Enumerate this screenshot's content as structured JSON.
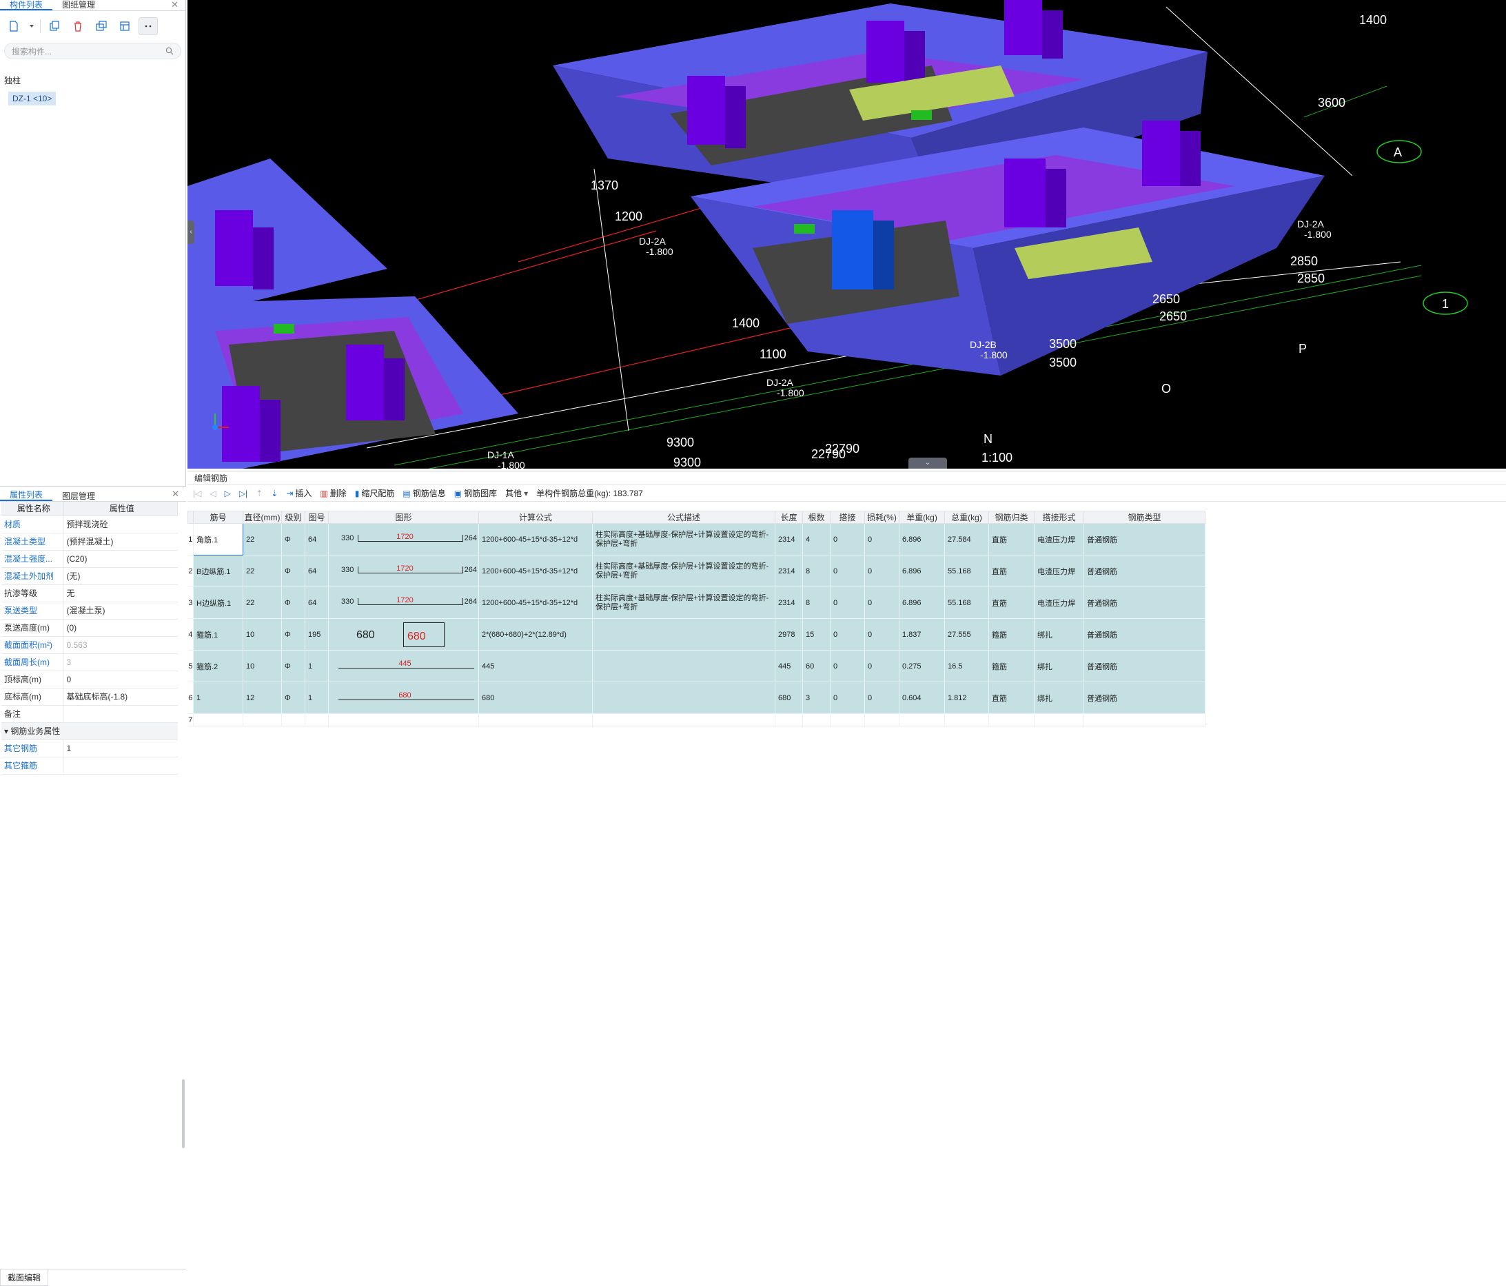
{
  "left_panel": {
    "tabs": [
      "构件列表",
      "图纸管理"
    ],
    "search_placeholder": "搜索构件...",
    "tree_group": "独柱",
    "tree_item": "DZ-1 <10>"
  },
  "props_panel": {
    "tabs": [
      "属性列表",
      "图层管理"
    ],
    "headers": [
      "属性名称",
      "属性值"
    ],
    "rows": [
      {
        "name": "材质",
        "value": "预拌现浇砼",
        "blue": true
      },
      {
        "name": "混凝土类型",
        "value": "(预拌混凝土)",
        "blue": true
      },
      {
        "name": "混凝土强度...",
        "value": "(C20)",
        "blue": true
      },
      {
        "name": "混凝土外加剂",
        "value": "(无)",
        "blue": true
      },
      {
        "name": "抗渗等级",
        "value": "无",
        "blue": false
      },
      {
        "name": "泵送类型",
        "value": "(混凝土泵)",
        "blue": true
      },
      {
        "name": "泵送高度(m)",
        "value": "(0)",
        "blue": false
      },
      {
        "name": "截面面积(m²)",
        "value": "0.563",
        "blue": true,
        "gray": true
      },
      {
        "name": "截面周长(m)",
        "value": "3",
        "blue": true,
        "gray": true
      },
      {
        "name": "顶标高(m)",
        "value": "0",
        "blue": false
      },
      {
        "name": "底标高(m)",
        "value": "基础底标高(-1.8)",
        "blue": false
      },
      {
        "name": "备注",
        "value": "",
        "blue": false
      }
    ],
    "section": "钢筋业务属性",
    "extra_rows": [
      {
        "name": "其它钢筋",
        "value": "1"
      },
      {
        "name": "其它箍筋",
        "value": ""
      }
    ],
    "bottom_tab": "截面编辑"
  },
  "viewport": {
    "dims": [
      "9300",
      "9300",
      "22790",
      "22790",
      "3500",
      "3500",
      "2650",
      "2650",
      "2850",
      "2850",
      "3600",
      "1400",
      "1100",
      "1200",
      "1370",
      "1400"
    ],
    "labels": [
      "DJ-1A",
      "-1.800",
      "DJ-2A",
      "-1.800",
      "DJ-2B",
      "-1.800",
      "DJ-2A",
      "-1.800",
      "DJ-2A",
      "-1.800"
    ],
    "axis_labels": [
      "A",
      "1",
      "P",
      "O",
      "N"
    ],
    "scale": "1:100"
  },
  "editor": {
    "title": "编辑钢筋",
    "toolbar": {
      "insert": "插入",
      "delete": "删除",
      "scale_rebar": "缩尺配筋",
      "rebar_info": "钢筋信息",
      "rebar_lib": "钢筋图库",
      "other": "其他",
      "total": "单构件钢筋总重(kg): 183.787"
    },
    "columns": [
      "筋号",
      "直径(mm)",
      "级别",
      "图号",
      "图形",
      "计算公式",
      "公式描述",
      "长度",
      "根数",
      "搭接",
      "损耗(%)",
      "单重(kg)",
      "总重(kg)",
      "钢筋归类",
      "搭接形式",
      "钢筋类型"
    ],
    "rows": [
      {
        "no": "1",
        "name": "角筋.1",
        "dia": "22",
        "grade": "Φ",
        "fig": "64",
        "shape_left": "330",
        "shape_mid": "1720",
        "shape_right": "264",
        "formula": "1200+600-45+15*d-35+12*d",
        "desc": "柱实际高度+基础厚度-保护层+计算设置设定的弯折-保护层+弯折",
        "len": "2314",
        "count": "4",
        "lap": "0",
        "loss": "0",
        "unit_w": "6.896",
        "total_w": "27.584",
        "cls": "直筋",
        "lap_form": "电渣压力焊",
        "type": "普通钢筋"
      },
      {
        "no": "2",
        "name": "B边纵筋.1",
        "dia": "22",
        "grade": "Φ",
        "fig": "64",
        "shape_left": "330",
        "shape_mid": "1720",
        "shape_right": "264",
        "formula": "1200+600-45+15*d-35+12*d",
        "desc": "柱实际高度+基础厚度-保护层+计算设置设定的弯折-保护层+弯折",
        "len": "2314",
        "count": "8",
        "lap": "0",
        "loss": "0",
        "unit_w": "6.896",
        "total_w": "55.168",
        "cls": "直筋",
        "lap_form": "电渣压力焊",
        "type": "普通钢筋"
      },
      {
        "no": "3",
        "name": "H边纵筋.1",
        "dia": "22",
        "grade": "Φ",
        "fig": "64",
        "shape_left": "330",
        "shape_mid": "1720",
        "shape_right": "264",
        "formula": "1200+600-45+15*d-35+12*d",
        "desc": "柱实际高度+基础厚度-保护层+计算设置设定的弯折-保护层+弯折",
        "len": "2314",
        "count": "8",
        "lap": "0",
        "loss": "0",
        "unit_w": "6.896",
        "total_w": "55.168",
        "cls": "直筋",
        "lap_form": "电渣压力焊",
        "type": "普通钢筋"
      },
      {
        "no": "4",
        "name": "箍筋.1",
        "dia": "10",
        "grade": "Φ",
        "fig": "195",
        "shape_left": "680",
        "shape_mid": "680",
        "shape_right": "",
        "formula": "2*(680+680)+2*(12.89*d)",
        "desc": "",
        "len": "2978",
        "count": "15",
        "lap": "0",
        "loss": "0",
        "unit_w": "1.837",
        "total_w": "27.555",
        "cls": "箍筋",
        "lap_form": "绑扎",
        "type": "普通钢筋"
      },
      {
        "no": "5",
        "name": "箍筋.2",
        "dia": "10",
        "grade": "Φ",
        "fig": "1",
        "shape_left": "",
        "shape_mid": "445",
        "shape_right": "",
        "formula": "445",
        "desc": "",
        "len": "445",
        "count": "60",
        "lap": "0",
        "loss": "0",
        "unit_w": "0.275",
        "total_w": "16.5",
        "cls": "箍筋",
        "lap_form": "绑扎",
        "type": "普通钢筋"
      },
      {
        "no": "6",
        "name": "1",
        "dia": "12",
        "grade": "Φ",
        "fig": "1",
        "shape_left": "",
        "shape_mid": "680",
        "shape_right": "",
        "formula": "680",
        "desc": "",
        "len": "680",
        "count": "3",
        "lap": "0",
        "loss": "0",
        "unit_w": "0.604",
        "total_w": "1.812",
        "cls": "直筋",
        "lap_form": "绑扎",
        "type": "普通钢筋"
      }
    ],
    "empty_row_no": "7"
  }
}
